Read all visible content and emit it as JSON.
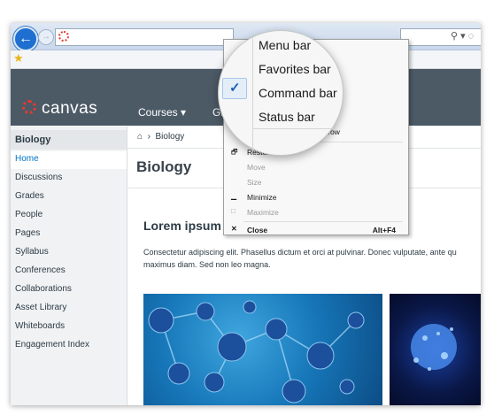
{
  "browser": {
    "back_icon": "arrow-left",
    "forward_icon": "arrow-right",
    "search_glyph": "⚲ ▾ ◌"
  },
  "header": {
    "logo_text": "canvas",
    "nav": {
      "courses": "Courses ▾",
      "grades_partial": "Gr"
    }
  },
  "sidebar": {
    "title": "Biology",
    "items": [
      {
        "label": "Home"
      },
      {
        "label": "Discussions"
      },
      {
        "label": "Grades"
      },
      {
        "label": "People"
      },
      {
        "label": "Pages"
      },
      {
        "label": "Syllabus"
      },
      {
        "label": "Conferences"
      },
      {
        "label": "Collaborations"
      },
      {
        "label": "Asset Library"
      },
      {
        "label": "Whiteboards"
      },
      {
        "label": "Engagement Index"
      }
    ]
  },
  "main": {
    "breadcrumb": "Biology",
    "title": "Biology",
    "heading": "Lorem ipsum",
    "body_line1": "Consectetur adipiscing elit. Phasellus dictum et orci at pulvinar. Donec vulputate, ante qu",
    "body_line2": "maximus diam. Sed non leo magna."
  },
  "context_menu": {
    "partial_row": "eparate row",
    "restore": "Restore",
    "move": "Move",
    "size": "Size",
    "minimize": "Minimize",
    "maximize": "Maximize",
    "close": "Close",
    "close_shortcut": "Alt+F4"
  },
  "magnifier": {
    "menu_bar": "Menu bar",
    "favorites_bar": "Favorites bar",
    "command_bar": "Command bar",
    "status_bar": "Status bar",
    "check": "✓"
  },
  "colors": {
    "header_bg": "#4c5a66",
    "accent": "#0074c2",
    "logo_red": "#e23b2e"
  }
}
